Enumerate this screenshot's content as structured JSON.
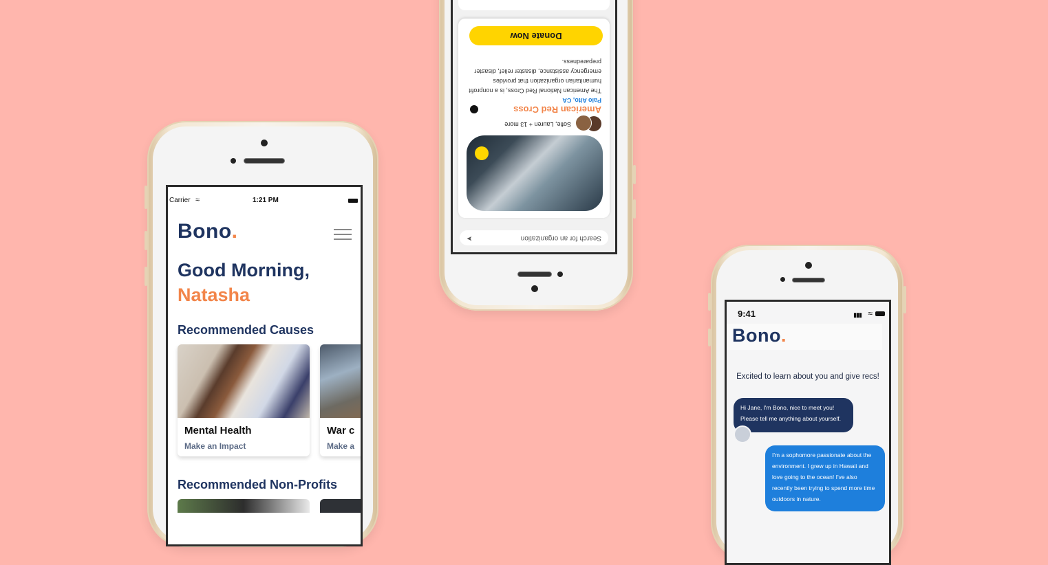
{
  "colors": {
    "background": "#ffb6ad",
    "navy": "#1f3460",
    "orange": "#f2854a",
    "yellow": "#ffd400",
    "blue": "#1e7fdc"
  },
  "phone1": {
    "status": {
      "carrier": "Carrier",
      "time": "1:21 PM"
    },
    "logo": "Bono",
    "logo_dot": ".",
    "greeting": "Good Morning,",
    "user_name": "Natasha",
    "recommended_causes_title": "Recommended Causes",
    "causes": [
      {
        "title": "Mental Health",
        "subtitle": "Make an Impact"
      },
      {
        "title": "War c",
        "subtitle": "Make a"
      }
    ],
    "recommended_nonprofits_title": "Recommended Non-Profits"
  },
  "phone2": {
    "search_placeholder": "Search for an organization",
    "org_name": "American Red Cross",
    "org_location": "Palo Alto, CA",
    "supporters": "Sofie, Lauren + 13 more",
    "description": "The American National Red Cross, is a nonprofit humanitarian organization that provides emergency assistance, disaster relief, disaster preparedness.",
    "donate_label": "Donate Now"
  },
  "phone3": {
    "status_time": "9:41",
    "logo": "Bono",
    "logo_dot": ".",
    "intro": "Excited to learn about you and give recs!",
    "bot_message": "Hi Jane, I'm Bono, nice to meet you! Please tell me anything about yourself.",
    "user_message": "I'm a sophomore passionate about the environment. I grew up in Hawaii and love going to the ocean! I've also recently been trying to spend more time outdoors in nature."
  }
}
